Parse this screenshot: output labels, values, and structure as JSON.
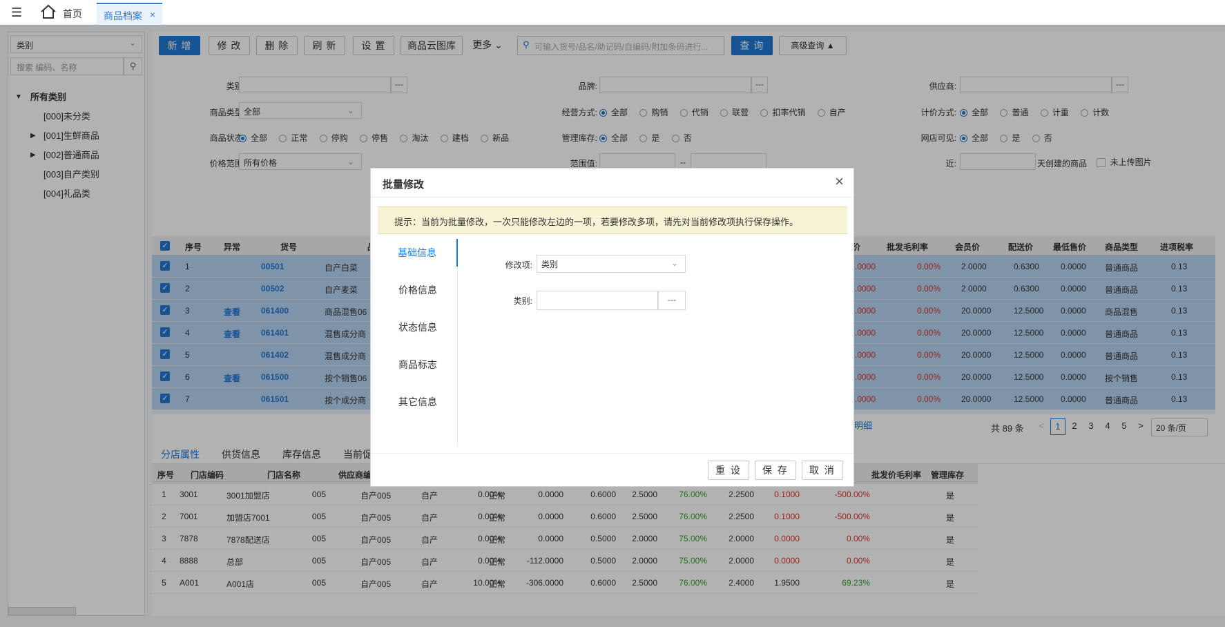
{
  "topbar": {
    "home_label": "首页",
    "tab_label": "商品档案",
    "tab_close": "×"
  },
  "sidebar": {
    "select_value": "类别",
    "search_placeholder": "搜索 编码、名称",
    "tree": [
      {
        "label": "所有类别",
        "level": 0,
        "expanded": true
      },
      {
        "label": "[000]未分类",
        "level": 1,
        "expandable": false
      },
      {
        "label": "[001]生鲜商品",
        "level": 1,
        "expandable": true
      },
      {
        "label": "[002]普通商品",
        "level": 1,
        "expandable": true
      },
      {
        "label": "[003]自产类别",
        "level": 1,
        "expandable": false
      },
      {
        "label": "[004]礼品类",
        "level": 1,
        "expandable": false
      }
    ]
  },
  "toolbar": {
    "add": "新 增",
    "edit": "修 改",
    "delete": "删 除",
    "refresh": "刷 新",
    "settings": "设 置",
    "cloud": "商品云图库",
    "more": "更多",
    "search_placeholder": "可输入货号/品名/助记码/自编码/附加条码进行...",
    "query": "查 询",
    "advanced": "高级查询"
  },
  "filters": {
    "category_label": "类别:",
    "brand_label": "品牌:",
    "supplier_label": "供应商:",
    "goods_type_label": "商品类型:",
    "goods_type_value": "全部",
    "business_label": "经营方式:",
    "business_options": [
      "全部",
      "购销",
      "代销",
      "联营",
      "扣率代销",
      "自产"
    ],
    "pricing_label": "计价方式:",
    "pricing_options": [
      "全部",
      "普通",
      "计重",
      "计数"
    ],
    "status_label": "商品状态:",
    "status_options": [
      "全部",
      "正常",
      "停购",
      "停售",
      "淘汰",
      "建档",
      "新品"
    ],
    "stock_label": "管理库存:",
    "stock_options": [
      "全部",
      "是",
      "否"
    ],
    "online_label": "网店可见:",
    "online_options": [
      "全部",
      "是",
      "否"
    ],
    "price_range_label": "价格范围:",
    "price_range_value": "所有价格",
    "range_label": "范围值:",
    "range_sep": "--",
    "recent_label": "近:",
    "recent_suffix": "天创建的商品",
    "no_image_label": "未上传图片"
  },
  "grid": {
    "headers": {
      "no": "序号",
      "abnormal": "异常",
      "code": "货号",
      "name": "品",
      "price": "价",
      "wholesale_margin": "批发毛利率",
      "member": "会员价",
      "delivery": "配送价",
      "min_price": "最低售价",
      "type": "商品类型",
      "tax": "进项税率"
    },
    "rows": [
      {
        "no": "1",
        "abnormal": "",
        "code": "00501",
        "name": "自产白菜",
        "price": ".0000",
        "wm": "0.00%",
        "member": "2.0000",
        "delivery": "0.6300",
        "min": "0.0000",
        "type": "普通商品",
        "tax": "0.13"
      },
      {
        "no": "2",
        "abnormal": "",
        "code": "00502",
        "name": "自产麦菜",
        "price": ".0000",
        "wm": "0.00%",
        "member": "2.0000",
        "delivery": "0.6300",
        "min": "0.0000",
        "type": "普通商品",
        "tax": "0.13"
      },
      {
        "no": "3",
        "abnormal": "查看",
        "code": "061400",
        "name": "商品混售06",
        "price": ".0000",
        "wm": "0.00%",
        "member": "20.0000",
        "delivery": "12.5000",
        "min": "0.0000",
        "type": "商品混售",
        "tax": "0.13"
      },
      {
        "no": "4",
        "abnormal": "查看",
        "code": "061401",
        "name": "混售成分商",
        "price": ".0000",
        "wm": "0.00%",
        "member": "20.0000",
        "delivery": "12.5000",
        "min": "0.0000",
        "type": "普通商品",
        "tax": "0.13"
      },
      {
        "no": "5",
        "abnormal": "",
        "code": "061402",
        "name": "混售成分商",
        "price": ".0000",
        "wm": "0.00%",
        "member": "20.0000",
        "delivery": "12.5000",
        "min": "0.0000",
        "type": "普通商品",
        "tax": "0.13"
      },
      {
        "no": "6",
        "abnormal": "查看",
        "code": "061500",
        "name": "按个销售06",
        "price": ".0000",
        "wm": "0.00%",
        "member": "20.0000",
        "delivery": "12.5000",
        "min": "0.0000",
        "type": "按个销售",
        "tax": "0.13"
      },
      {
        "no": "7",
        "abnormal": "",
        "code": "061501",
        "name": "按个成分商",
        "price": ".0000",
        "wm": "0.00%",
        "member": "20.0000",
        "delivery": "12.5000",
        "min": "0.0000",
        "type": "普通商品",
        "tax": "0.13"
      }
    ]
  },
  "pager": {
    "detail_link": "明细",
    "total": "共 89 条",
    "pages": [
      "1",
      "2",
      "3",
      "4",
      "5"
    ],
    "current": "1",
    "page_size": "20 条/页"
  },
  "bottom_tabs": [
    "分店属性",
    "供货信息",
    "库存信息",
    "当前促"
  ],
  "bottom_table": {
    "headers": {
      "no": "序号",
      "store_code": "门店编码",
      "store_name": "门店名称",
      "supplier": "供应商编",
      "wholesale_margin": "批发价毛利率",
      "manage_stock": "管理库存"
    },
    "rows": [
      {
        "no": "1",
        "code": "3001",
        "name": "3001加盟店",
        "sup": "005",
        "sup2": "自产005",
        "mode": "自产",
        "rate": "0.00%",
        "status": "正常",
        "v1": "0.0000",
        "v2": "0.6000",
        "v3": "2.5000",
        "pct": "76.00%",
        "v4": "2.2500",
        "v5": "0.1000",
        "wm": "-500.00%",
        "stock": "是"
      },
      {
        "no": "2",
        "code": "7001",
        "name": "加盟店7001",
        "sup": "005",
        "sup2": "自产005",
        "mode": "自产",
        "rate": "0.00%",
        "status": "正常",
        "v1": "0.0000",
        "v2": "0.6000",
        "v3": "2.5000",
        "pct": "76.00%",
        "v4": "2.2500",
        "v5": "0.1000",
        "wm": "-500.00%",
        "stock": "是"
      },
      {
        "no": "3",
        "code": "7878",
        "name": "7878配送店",
        "sup": "005",
        "sup2": "自产005",
        "mode": "自产",
        "rate": "0.00%",
        "status": "正常",
        "v1": "0.0000",
        "v2": "0.5000",
        "v3": "2.0000",
        "pct": "75.00%",
        "v4": "2.0000",
        "v5": "0.0000",
        "wm": "0.00%",
        "stock": "是"
      },
      {
        "no": "4",
        "code": "8888",
        "name": "总部",
        "sup": "005",
        "sup2": "自产005",
        "mode": "自产",
        "rate": "0.00%",
        "status": "正常",
        "v1": "-112.0000",
        "v2": "0.5000",
        "v3": "2.0000",
        "pct": "75.00%",
        "v4": "2.0000",
        "v5": "0.0000",
        "wm": "0.00%",
        "stock": "是"
      },
      {
        "no": "5",
        "code": "A001",
        "name": "A001店",
        "sup": "005",
        "sup2": "自产005",
        "mode": "自产",
        "rate": "10.00%",
        "status": "正常",
        "v1": "-306.0000",
        "v2": "0.6000",
        "v3": "2.5000",
        "pct": "76.00%",
        "v4": "2.4000",
        "v5": "1.9500",
        "wm": "69.23%",
        "stock": "是"
      }
    ]
  },
  "modal": {
    "title": "批量修改",
    "close": "×",
    "tip": "提示：当前为批量修改，一次只能修改左边的一项，若要修改多项，请先对当前修改项执行保存操作。",
    "tabs": [
      "基础信息",
      "价格信息",
      "状态信息",
      "商品标志",
      "其它信息"
    ],
    "active_tab": "基础信息",
    "field_label": "修改项:",
    "field_value": "类别",
    "category_label": "类别:",
    "category_value": "",
    "dots": "---",
    "reset": "重 设",
    "save": "保 存",
    "cancel": "取 消"
  },
  "colors": {
    "primary": "#1f78d1",
    "red": "#e0302a",
    "green": "#2e9b2e",
    "row_selected": "#b6d4f2",
    "tip_bg": "#f7f4d6"
  }
}
